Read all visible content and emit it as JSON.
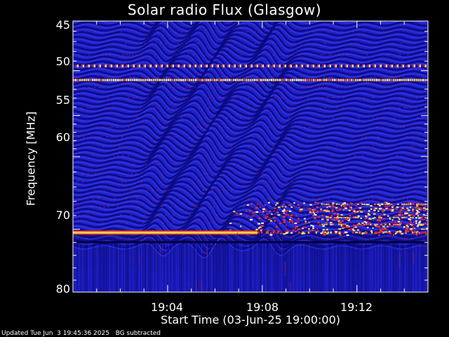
{
  "chart_data": {
    "type": "heatmap",
    "title": "Solar radio Flux (Glasgow)",
    "ylabel": "Frequency [MHz]",
    "xlabel": "Start Time (03-Jun-25 19:00:00)",
    "yticks": [
      "45",
      "50",
      "55",
      "60",
      "70",
      "80"
    ],
    "xticks": [
      "19:04",
      "19:08",
      "19:12"
    ],
    "ylim": [
      45,
      80
    ],
    "yscale": "log",
    "xlim_minutes": [
      0,
      15
    ],
    "colormap": [
      "#000066",
      "#1a1ad0",
      "#3a3af0",
      "#b01a3a",
      "#ff3a10",
      "#ffd040",
      "#ffffff"
    ],
    "features": {
      "bright_band_mhz": [
        51
      ],
      "dotted_band_mhz": [
        49.5
      ],
      "strong_rfi_band_mhz": [
        70.5,
        71.8
      ],
      "late_activity_band_mhz": [
        66,
        70
      ]
    }
  },
  "footer": {
    "updated": "Updated Tue Jun  3 19:45:36 2025",
    "bg": "BG subtracted"
  }
}
